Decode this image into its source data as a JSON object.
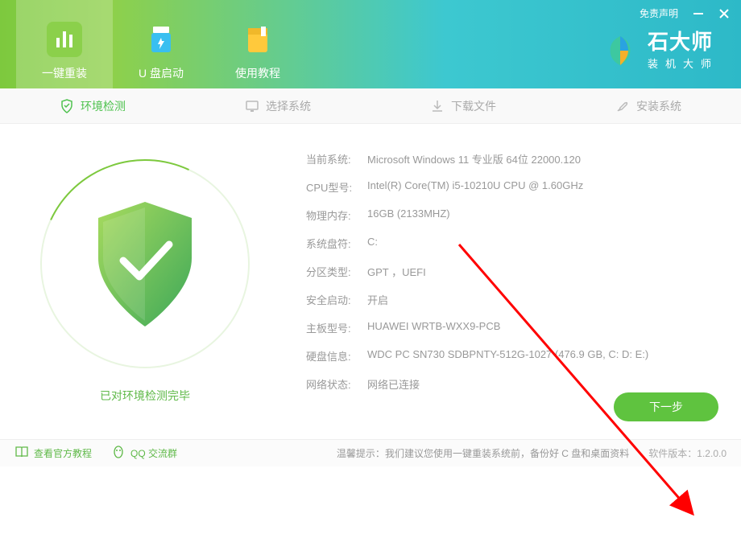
{
  "header": {
    "disclaimer": "免责声明",
    "tabs": [
      {
        "label": "一键重装",
        "icon": "chart"
      },
      {
        "label": "U 盘启动",
        "icon": "usb"
      },
      {
        "label": "使用教程",
        "icon": "book"
      }
    ]
  },
  "brand": {
    "title": "石大师",
    "subtitle": "装机大师"
  },
  "steps": [
    {
      "label": "环境检测",
      "icon": "shield",
      "active": true
    },
    {
      "label": "选择系统",
      "icon": "monitor",
      "active": false
    },
    {
      "label": "下载文件",
      "icon": "download",
      "active": false
    },
    {
      "label": "安装系统",
      "icon": "wrench",
      "active": false
    }
  ],
  "detection_done": "已对环境检测完毕",
  "sysinfo": [
    {
      "label": "当前系统:",
      "value": "Microsoft Windows 11 专业版 64位 22000.120"
    },
    {
      "label": "CPU型号:",
      "value": "Intel(R) Core(TM) i5-10210U CPU @ 1.60GHz"
    },
    {
      "label": "物理内存:",
      "value": "16GB (2133MHZ)"
    },
    {
      "label": "系统盘符:",
      "value": "C:"
    },
    {
      "label": "分区类型:",
      "value": "GPT ，UEFI"
    },
    {
      "label": "安全启动:",
      "value": "开启"
    },
    {
      "label": "主板型号:",
      "value": "HUAWEI WRTB-WXX9-PCB"
    },
    {
      "label": "硬盘信息:",
      "value": "WDC PC SN730 SDBPNTY-512G-1027   (476.9 GB, C: D: E:)"
    },
    {
      "label": "网络状态:",
      "value": "网络已连接"
    }
  ],
  "next_button": "下一步",
  "footer": {
    "tutorial": "查看官方教程",
    "qq": "QQ 交流群",
    "tip_label": "温馨提示：",
    "tip_text": "我们建议您使用一键重装系统前，备份好 C 盘和桌面资料",
    "version_label": "软件版本：",
    "version": "1.2.0.0"
  }
}
